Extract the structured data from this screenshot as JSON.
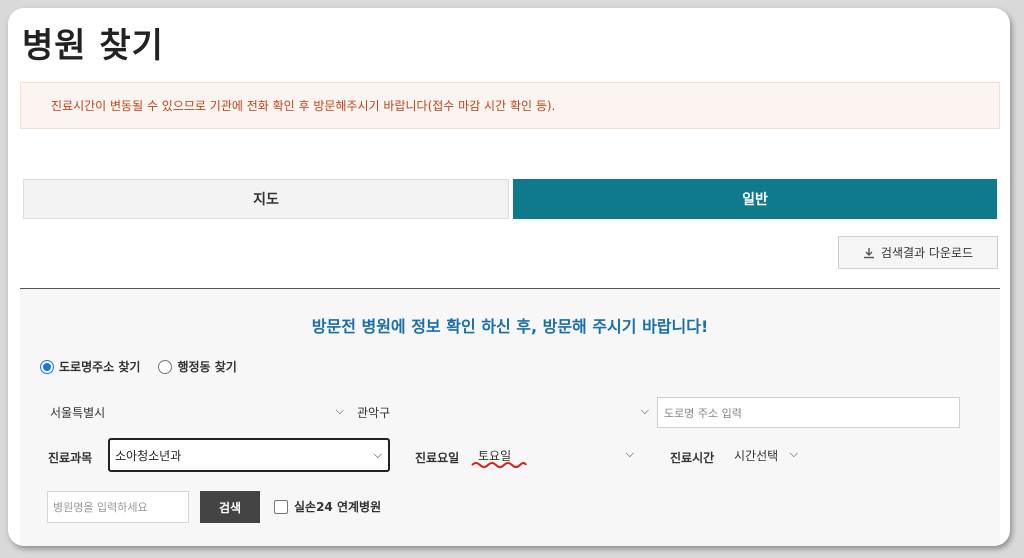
{
  "page": {
    "title": "병원 찾기"
  },
  "notice": {
    "text": "진료시간이 변동될 수 있으므로 기관에 전화 확인 후 방문해주시기 바랍니다(접수 마감 시간 확인 등)."
  },
  "tabs": [
    {
      "label": "지도",
      "active": false
    },
    {
      "label": "일반",
      "active": true
    }
  ],
  "toolbar": {
    "download_label": "검색결과 다운로드",
    "download_icon": "download-icon"
  },
  "search": {
    "heading": "방문전 병원에 정보 확인 하신 후, 방문해 주시기 바랍니다!",
    "address_modes": [
      {
        "label": "도로명주소 찾기",
        "selected": true
      },
      {
        "label": "행정동 찾기",
        "selected": false
      }
    ],
    "city_select": "서울특별시",
    "district_select": "관악구",
    "road_address_placeholder": "도로명 주소 입력",
    "department_label": "진료과목",
    "department_value": "소아청소년과",
    "day_label": "진료요일",
    "day_value": "토요일",
    "time_label": "진료시간",
    "time_value": "시간선택",
    "hospital_name_placeholder": "병원명을 입력하세요",
    "search_button": "검색",
    "silson_label": "실손24 연계병원",
    "silson_checked": false
  },
  "colors": {
    "tab_active": "#0e7a8c",
    "notice_text": "#c0461b",
    "heading": "#1b6fa8",
    "squiggle": "#d9221c"
  }
}
